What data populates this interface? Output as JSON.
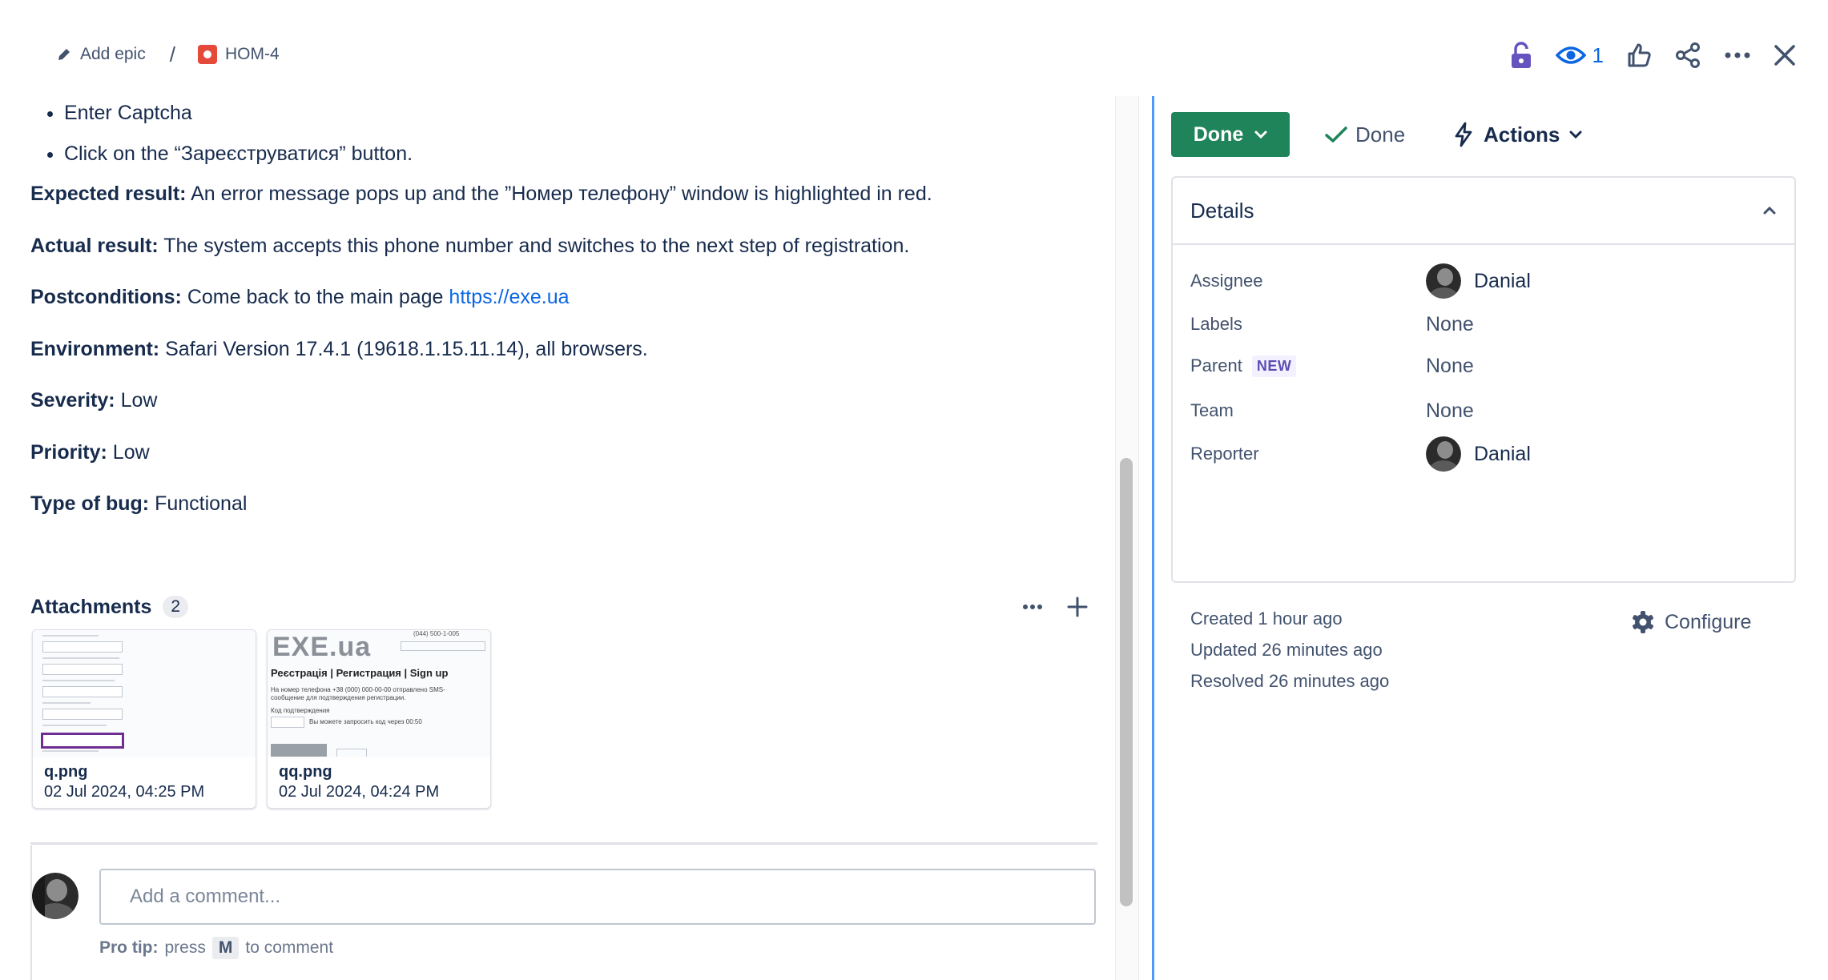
{
  "breadcrumb": {
    "add_epic": "Add epic",
    "separator": "/",
    "issue_key": "HOM-4"
  },
  "header": {
    "watch_count": "1",
    "icons": [
      "unlock-icon",
      "eye-icon",
      "thumbs-up-icon",
      "share-icon",
      "more-icon",
      "close-icon"
    ]
  },
  "description": {
    "steps": [
      "Enter Captcha",
      "Click on the “Зареєструватися” button."
    ],
    "expected_label": "Expected result:",
    "expected_text": " An error message pops up and the ”Номер телефону” window is highlighted in red.",
    "actual_label": "Actual result:",
    "actual_text": " The system accepts this phone number and switches to the next step of registration.",
    "post_label": "Postconditions:",
    "post_text": " Come back to the main page ",
    "post_link": "https://exe.ua",
    "env_label": "Environment:",
    "env_text": " Safari Version 17.4.1 (19618.1.15.11.14), all browsers.",
    "severity_label": "Severity:",
    "severity_text": " Low",
    "priority_label": "Priority:",
    "priority_text": " Low",
    "type_label": "Type of bug:",
    "type_text": " Functional"
  },
  "attachments": {
    "title": "Attachments",
    "count": "2",
    "items": [
      {
        "name": "q.png",
        "date": "02 Jul 2024, 04:25 PM"
      },
      {
        "name": "qq.png",
        "date": "02 Jul 2024, 04:24 PM"
      }
    ],
    "thumb2": {
      "logo": "EXE.ua",
      "phone": "(044) 500-1-005",
      "heading": "Реєстрація | Регистрация | Sign up",
      "line1": "На номер телефона +38 (000) 000-00-00 отправлено SMS-",
      "line2": "сообщение для подтверждения регистрации.",
      "line3": "Код подтверждения",
      "line4": "Вы можете запросить код через 00:50"
    }
  },
  "comment": {
    "placeholder": "Add a comment...",
    "protip_label": "Pro tip:",
    "protip_press": "press",
    "protip_key": "M",
    "protip_suffix": "to comment"
  },
  "status": {
    "button_label": "Done",
    "resolution": "Done",
    "actions_label": "Actions"
  },
  "details": {
    "title": "Details",
    "fields": [
      {
        "label": "Assignee",
        "value": "Danial"
      },
      {
        "label": "Labels",
        "value": "None"
      },
      {
        "label": "Parent",
        "badge": "NEW",
        "value": "None"
      },
      {
        "label": "Team",
        "value": "None"
      },
      {
        "label": "Reporter",
        "value": "Danial"
      }
    ]
  },
  "meta": {
    "created": "Created 1 hour ago",
    "updated": "Updated 26 minutes ago",
    "resolved": "Resolved 26 minutes ago",
    "configure": "Configure"
  },
  "colors": {
    "status_done": "#1f845a",
    "link": "#0c66e4",
    "bug_icon": "#e5493a",
    "lock_icon": "#6554c0",
    "watch": "#0c66e4"
  }
}
